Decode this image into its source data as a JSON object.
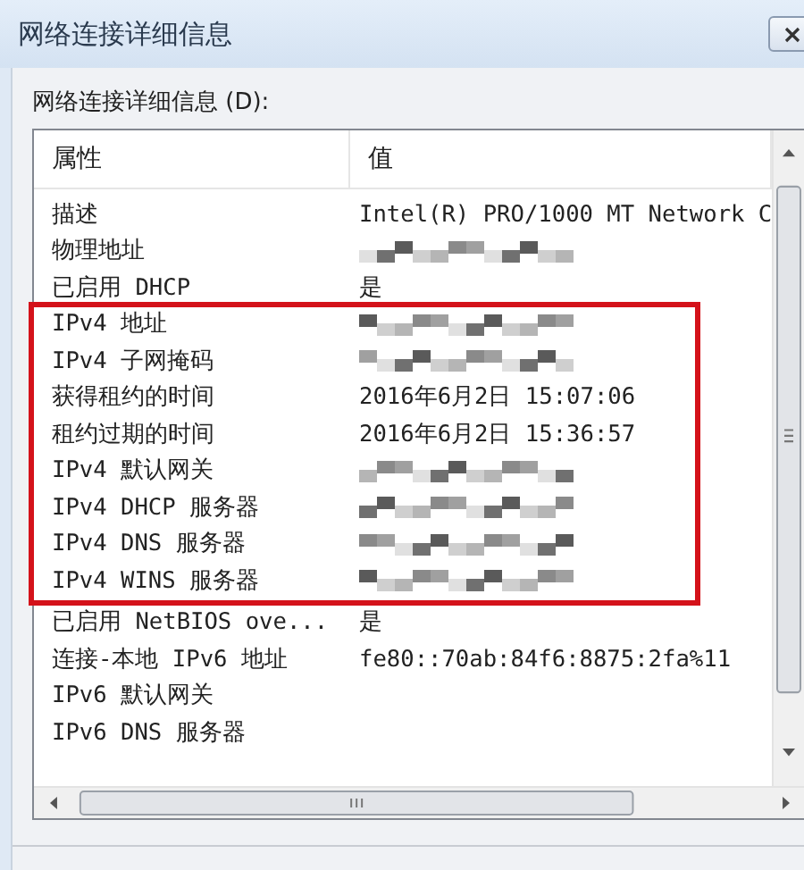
{
  "window": {
    "title": "网络连接详细信息"
  },
  "list_label": "网络连接详细信息 (D):",
  "table": {
    "columns": [
      "属性",
      "值"
    ],
    "row_groups": [
      {
        "highlighted": false,
        "rows": [
          {
            "property": "描述",
            "kind": "text",
            "value": "Intel(R) PRO/1000 MT Network C"
          },
          {
            "property": "物理地址",
            "kind": "redacted"
          },
          {
            "property": "已启用 DHCP",
            "kind": "text",
            "value": "是"
          }
        ]
      },
      {
        "highlighted": true,
        "rows": [
          {
            "property": "IPv4 地址",
            "kind": "redacted"
          },
          {
            "property": "IPv4 子网掩码",
            "kind": "redacted"
          },
          {
            "property": "获得租约的时间",
            "kind": "text",
            "value": "2016年6月2日 15:07:06"
          },
          {
            "property": "租约过期的时间",
            "kind": "text",
            "value": "2016年6月2日 15:36:57"
          },
          {
            "property": "IPv4 默认网关",
            "kind": "redacted"
          },
          {
            "property": "IPv4 DHCP 服务器",
            "kind": "redacted"
          },
          {
            "property": "IPv4 DNS 服务器",
            "kind": "redacted"
          },
          {
            "property": "IPv4 WINS 服务器",
            "kind": "redacted"
          }
        ]
      },
      {
        "highlighted": false,
        "rows": [
          {
            "property": "已启用 NetBIOS ove...",
            "kind": "text",
            "value": "是"
          },
          {
            "property": "连接-本地 IPv6 地址",
            "kind": "text",
            "value": "fe80::70ab:84f6:8875:2fa%11"
          },
          {
            "property": "IPv6 默认网关",
            "kind": "empty"
          },
          {
            "property": "IPv6 DNS 服务器",
            "kind": "empty"
          }
        ]
      }
    ]
  }
}
